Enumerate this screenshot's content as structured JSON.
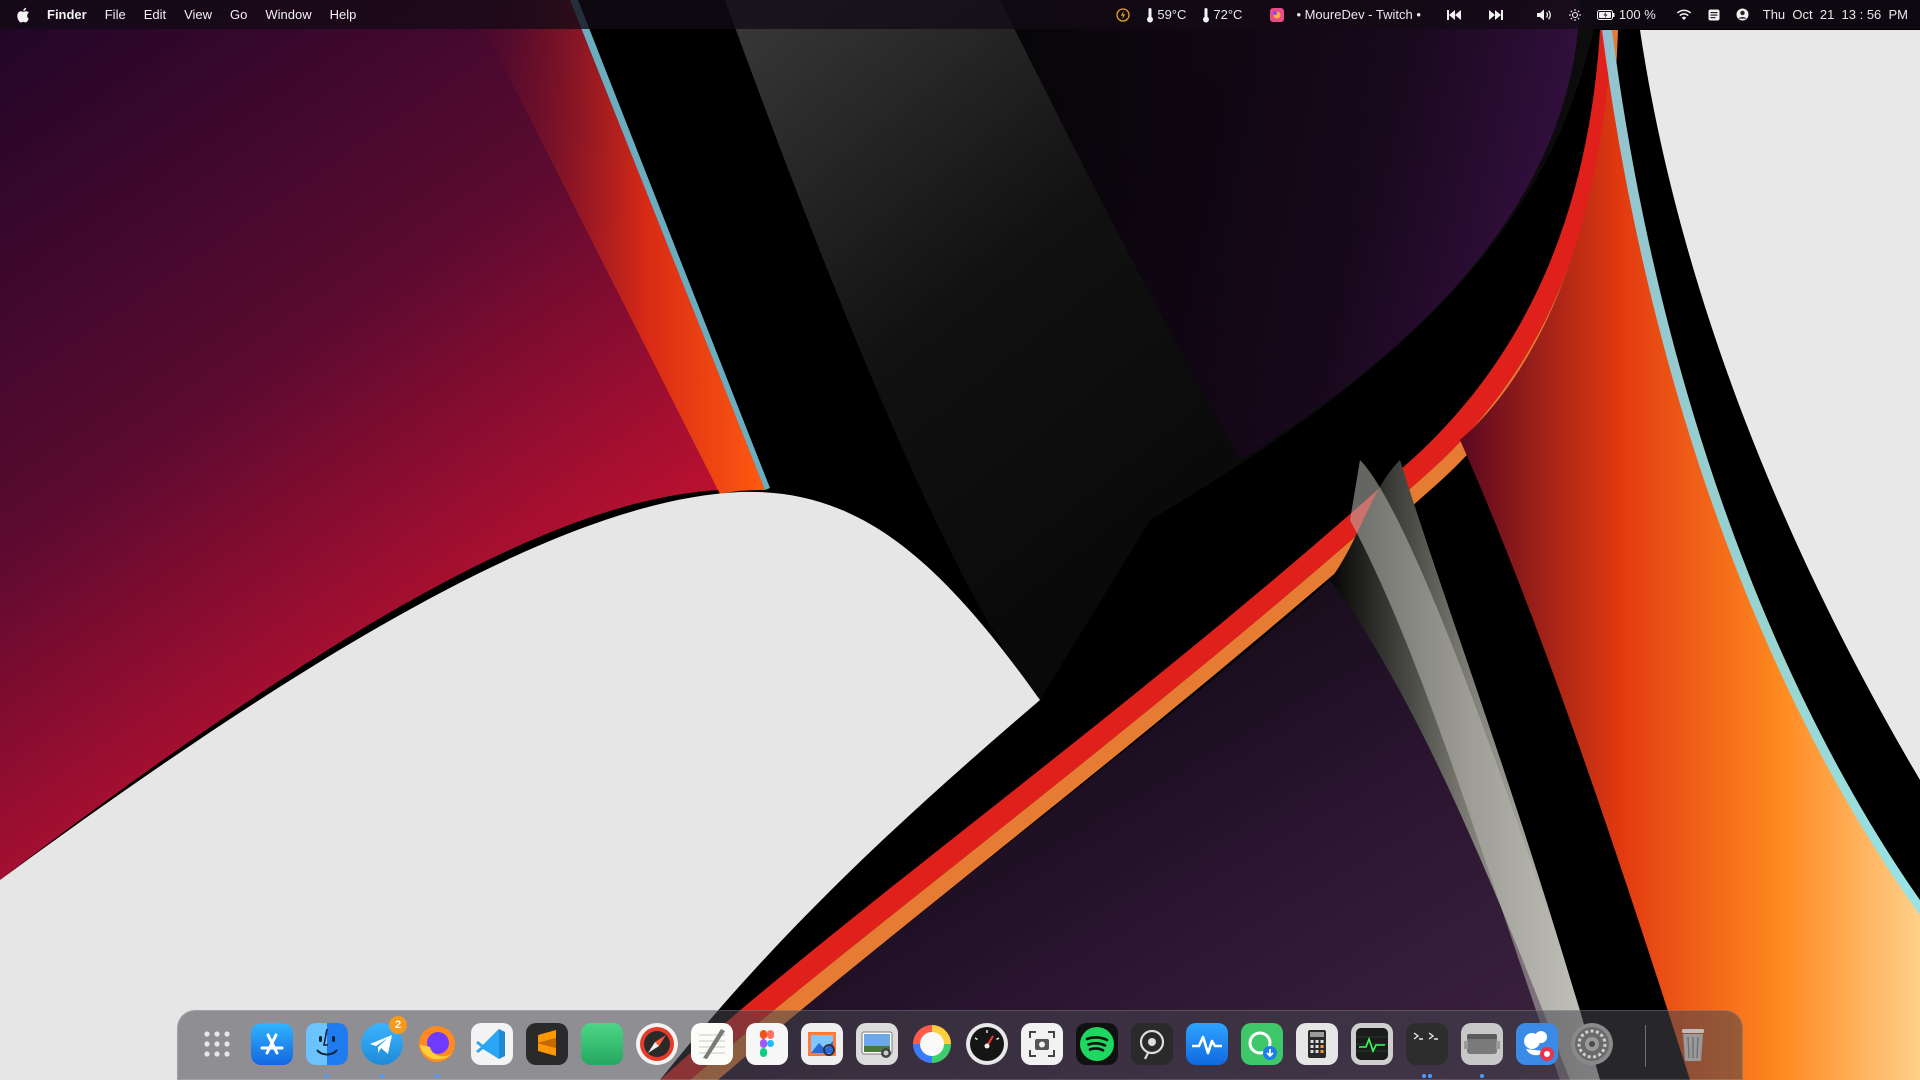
{
  "menubar": {
    "app_name": "Finder",
    "menus": [
      "File",
      "Edit",
      "View",
      "Go",
      "Window",
      "Help"
    ],
    "status": {
      "energy_icon": "lightning-icon",
      "temp_cpu": "59°C",
      "temp_gpu": "72°C",
      "now_playing": "• MoureDev - Twitch •",
      "battery": "100 %",
      "datetime": "Thu  Oct  21  13 : 56  PM"
    }
  },
  "dock": {
    "apps": [
      {
        "name": "Launchpad",
        "icon": "launchpad-icon"
      },
      {
        "name": "App Store",
        "icon": "app-store-icon"
      },
      {
        "name": "Finder",
        "icon": "finder-icon"
      },
      {
        "name": "Telegram",
        "icon": "telegram-icon",
        "badge": "2"
      },
      {
        "name": "Firefox",
        "icon": "firefox-icon"
      },
      {
        "name": "Visual Studio Code",
        "icon": "vscode-icon"
      },
      {
        "name": "Sublime Text",
        "icon": "sublime-icon"
      },
      {
        "name": "Green App",
        "icon": "green-app-icon"
      },
      {
        "name": "Compass",
        "icon": "compass-icon"
      },
      {
        "name": "TextEdit",
        "icon": "textedit-icon"
      },
      {
        "name": "Figma",
        "icon": "figma-icon"
      },
      {
        "name": "Preview",
        "icon": "preview-icon"
      },
      {
        "name": "Screenshot Viewer",
        "icon": "image-viewer-icon"
      },
      {
        "name": "Color Picker",
        "icon": "color-wheel-icon"
      },
      {
        "name": "Disk Diag",
        "icon": "gauge-icon"
      },
      {
        "name": "Screenshot",
        "icon": "screenshot-icon"
      },
      {
        "name": "Spotify",
        "icon": "spotify-icon"
      },
      {
        "name": "Podcast",
        "icon": "podcast-icon"
      },
      {
        "name": "Activity",
        "icon": "activity-icon"
      },
      {
        "name": "Downloader",
        "icon": "download-icon"
      },
      {
        "name": "Calculator",
        "icon": "calculator-icon"
      },
      {
        "name": "Activity Monitor",
        "icon": "activity-monitor-icon"
      },
      {
        "name": "Terminal",
        "icon": "terminal-icon"
      },
      {
        "name": "Finder Window",
        "icon": "window-icon"
      },
      {
        "name": "GIMP",
        "icon": "gimp-icon"
      },
      {
        "name": "System Preferences",
        "icon": "settings-icon"
      }
    ],
    "trash": {
      "name": "Trash",
      "icon": "trash-icon"
    }
  },
  "colors": {
    "menubar_bg": "#120a14",
    "accent_blue": "#4a9cff",
    "badge_orange": "#f59a1b"
  }
}
